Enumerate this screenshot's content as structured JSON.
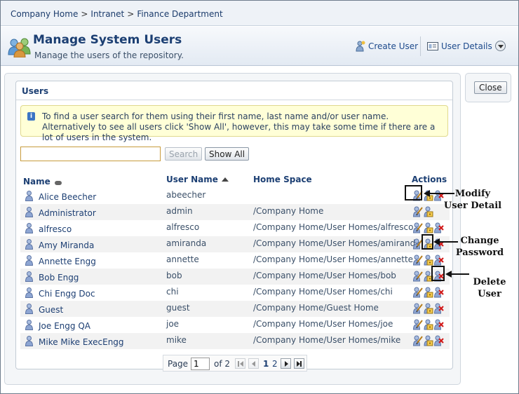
{
  "breadcrumb": {
    "items": [
      "Company Home",
      "Intranet",
      "Finance Department"
    ],
    "separator": ">"
  },
  "header": {
    "title": "Manage System Users",
    "subtitle": "Manage the users of the repository.",
    "create_user": "Create User",
    "user_details": "User Details"
  },
  "close_label": "Close",
  "panel": {
    "title": "Users",
    "info": "To find a user search for them using their first name, last name and/or user name. Alternatively to see all users click 'Show All', however, this may take some time if there are a lot of users in the system.",
    "search_value": "",
    "search_label": "Search",
    "show_all_label": "Show All"
  },
  "table": {
    "columns": [
      "Name",
      "User Name",
      "Home Space",
      "Actions"
    ],
    "sort_column": "User Name",
    "rows": [
      {
        "name": "Alice Beecher",
        "user": "abeecher",
        "home": "",
        "can_delete": true
      },
      {
        "name": "Administrator",
        "user": "admin",
        "home": "/Company Home",
        "can_delete": false
      },
      {
        "name": "alfresco",
        "user": "alfresco",
        "home": "/Company Home/User Homes/alfresco",
        "can_delete": true
      },
      {
        "name": "Amy Miranda",
        "user": "amiranda",
        "home": "/Company Home/User Homes/amiranda",
        "can_delete": true
      },
      {
        "name": "Annette Engg",
        "user": "annette",
        "home": "/Company Home/User Homes/annette",
        "can_delete": true
      },
      {
        "name": "Bob Engg",
        "user": "bob",
        "home": "/Company Home/User Homes/bob",
        "can_delete": true
      },
      {
        "name": "Chi Engg Doc",
        "user": "chi",
        "home": "/Company Home/User Homes/chi",
        "can_delete": true
      },
      {
        "name": "Guest",
        "user": "guest",
        "home": "/Company Home/Guest Home",
        "can_delete": true
      },
      {
        "name": "Joe Engg QA",
        "user": "joe",
        "home": "/Company Home/User Homes/joe",
        "can_delete": true
      },
      {
        "name": "Mike Mike ExecEngg",
        "user": "mike",
        "home": "/Company Home/User Homes/mike",
        "can_delete": true
      }
    ]
  },
  "pager": {
    "page_label": "Page",
    "current": "1",
    "of_label": "of 2",
    "pages": [
      "1",
      "2"
    ]
  },
  "callouts": {
    "modify": [
      "Modify",
      "User Detail"
    ],
    "password": [
      "Change",
      "Password"
    ],
    "delete": [
      "Delete",
      "User"
    ]
  },
  "icons": {
    "users": "users-group-icon",
    "create_user": "add-user-icon",
    "user_details": "user-details-icon",
    "person": "person-icon",
    "modify": "modify-user-icon",
    "password": "change-password-icon",
    "delete": "delete-user-icon",
    "info": "info-icon"
  },
  "colors": {
    "link": "#1d3f73",
    "info_bg": "#ffffd7",
    "header_bg": "#e3eaf3"
  }
}
